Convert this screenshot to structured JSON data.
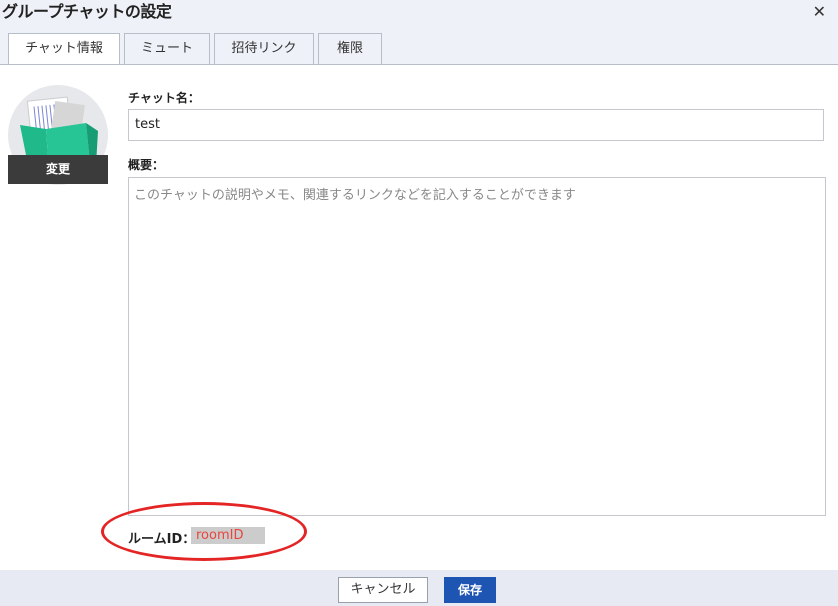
{
  "dialog": {
    "title": "グループチャットの設定",
    "close_icon": "close-icon"
  },
  "tabs": [
    {
      "label": "チャット情報",
      "active": true
    },
    {
      "label": "ミュート",
      "active": false
    },
    {
      "label": "招待リンク",
      "active": false
    },
    {
      "label": "権限",
      "active": false
    }
  ],
  "avatar": {
    "icon": "folder-icon",
    "change_label": "変更"
  },
  "form": {
    "chat_name_label": "チャット名：",
    "chat_name_value": "test",
    "summary_label": "概要：",
    "summary_placeholder": "このチャットの説明やメモ、関連するリンクなどを記入することができます",
    "room_id_label": "ルームID：",
    "room_id_value": "roomID"
  },
  "footer": {
    "cancel_label": "キャンセル",
    "save_label": "保存"
  },
  "colors": {
    "accent": "#1e55b3",
    "highlight": "#e42525",
    "room_id_text": "#e8463c"
  }
}
